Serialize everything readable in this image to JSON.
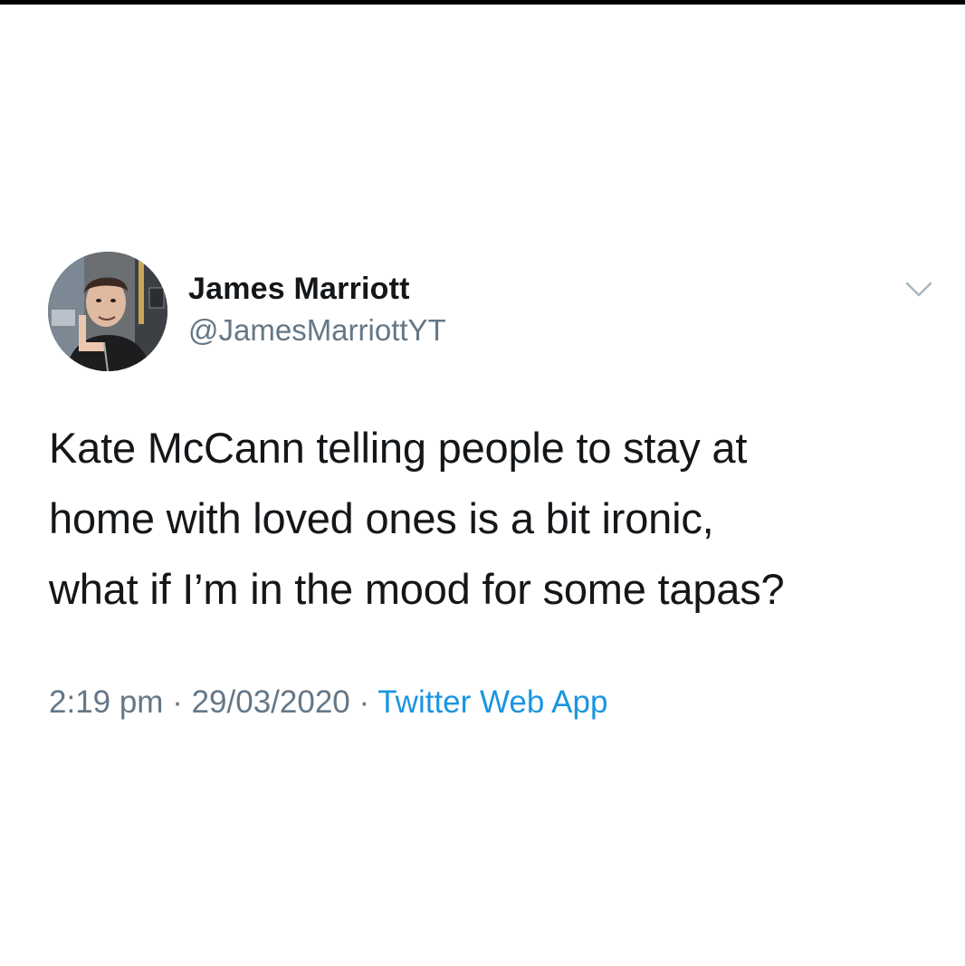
{
  "author": {
    "display_name": "James Marriott",
    "handle": "@JamesMarriottYT",
    "avatar_icon": "profile-photo"
  },
  "tweet": {
    "text": "Kate McCann telling people to stay at\nhome with loved ones is a bit ironic,\nwhat if I’m in the mood for some tapas?",
    "time": "2:19 pm",
    "separator": " · ",
    "date": "29/03/2020",
    "source": "Twitter Web App"
  },
  "menu": {
    "icon": "chevron-down-icon"
  },
  "colors": {
    "text": "#14171a",
    "secondary": "#657786",
    "link": "#1b95e0",
    "background": "#ffffff"
  }
}
